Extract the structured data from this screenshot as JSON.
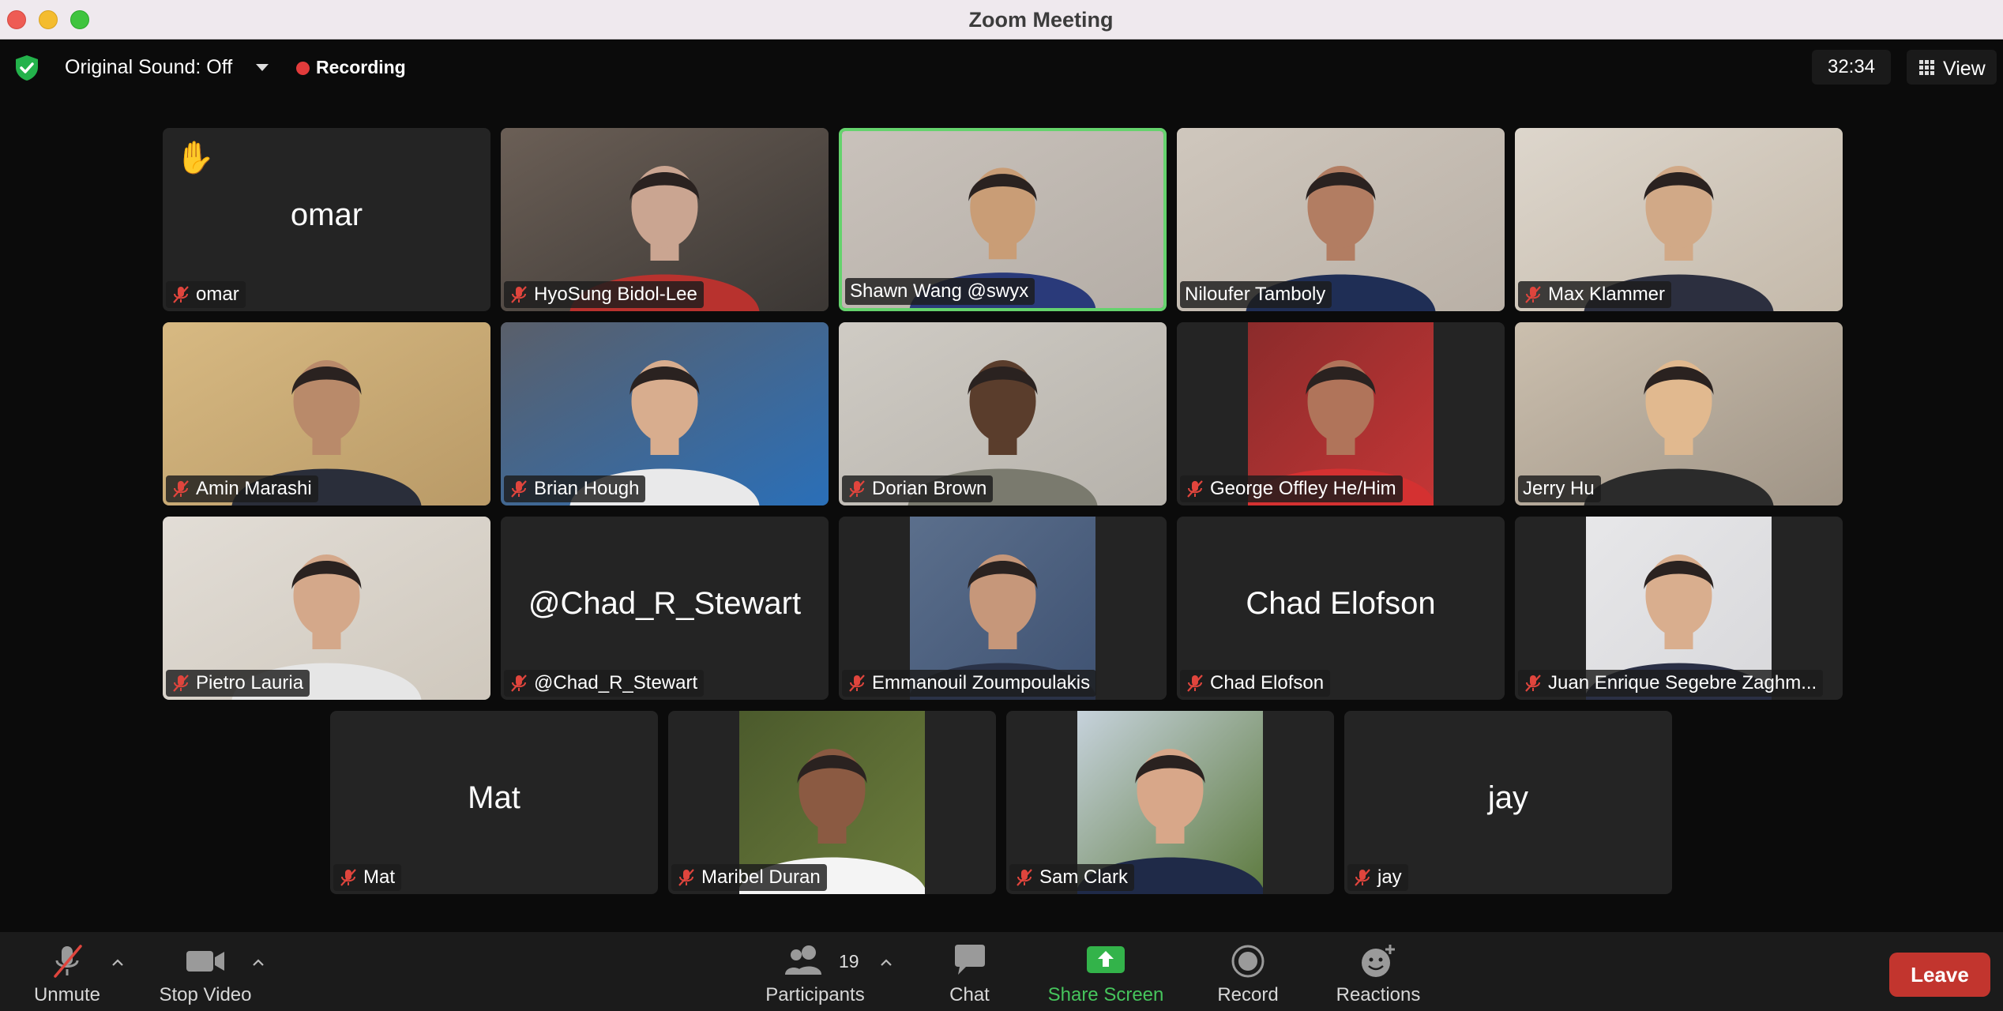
{
  "window": {
    "title": "Zoom Meeting"
  },
  "topbar": {
    "original_sound": "Original Sound: Off",
    "recording": "Recording",
    "timer": "32:34",
    "view": "View"
  },
  "participants": [
    {
      "name": "omar",
      "display": "omar",
      "muted": true,
      "video": false,
      "hand_raised": true
    },
    {
      "name": "HyoSung Bidol-Lee",
      "muted": true,
      "video": true
    },
    {
      "name": "Shawn Wang @swyx",
      "muted": false,
      "video": true,
      "active_speaker": true
    },
    {
      "name": "Niloufer Tamboly",
      "muted": false,
      "video": true
    },
    {
      "name": "Max Klammer",
      "muted": true,
      "video": true
    },
    {
      "name": "Amin Marashi",
      "muted": true,
      "video": true
    },
    {
      "name": "Brian Hough",
      "muted": true,
      "video": true
    },
    {
      "name": "Dorian Brown",
      "muted": true,
      "video": true
    },
    {
      "name": "George Offley He/Him",
      "muted": true,
      "video": true
    },
    {
      "name": "Jerry Hu",
      "muted": false,
      "video": true
    },
    {
      "name": "Pietro Lauria",
      "muted": true,
      "video": true
    },
    {
      "name": "@Chad_R_Stewart",
      "display": "@Chad_R_Stewart",
      "muted": true,
      "video": false
    },
    {
      "name": "Emmanouil Zoumpoulakis",
      "muted": true,
      "video": true
    },
    {
      "name": "Chad Elofson",
      "display": "Chad Elofson",
      "muted": true,
      "video": false
    },
    {
      "name": "Juan Enrique Segebre Zaghm...",
      "muted": true,
      "video": true
    },
    {
      "name": "Mat",
      "display": "Mat",
      "muted": true,
      "video": false
    },
    {
      "name": "Maribel Duran",
      "muted": true,
      "video": true
    },
    {
      "name": "Sam Clark",
      "muted": true,
      "video": true
    },
    {
      "name": "jay",
      "display": "jay",
      "muted": true,
      "video": false
    }
  ],
  "toolbar": {
    "unmute": "Unmute",
    "stop_video": "Stop Video",
    "participants": "Participants",
    "participant_count": "19",
    "chat": "Chat",
    "share_screen": "Share Screen",
    "record": "Record",
    "reactions": "Reactions",
    "leave": "Leave"
  },
  "colors": {
    "active_speaker_border": "#65d36d",
    "share_green": "#46c45c",
    "leave_red": "#c2352e",
    "muted_red": "#e0453d",
    "recording_dot": "#e23b3b"
  }
}
